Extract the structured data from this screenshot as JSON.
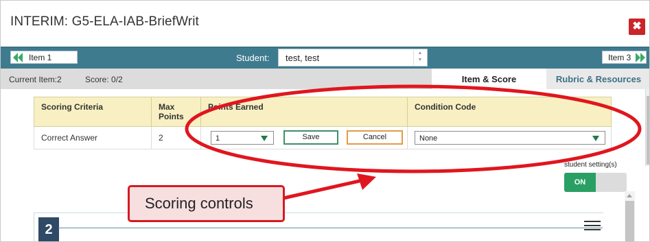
{
  "window": {
    "title": "INTERIM: G5-ELA-IAB-BriefWrit",
    "close_label": "✖"
  },
  "navbar": {
    "prev_item": "Item 1",
    "next_item": "Item 3",
    "student_label": "Student:",
    "student_value": "test, test"
  },
  "infobar": {
    "current_item": "Current Item:2",
    "score": "Score: 0/2",
    "tabs": [
      {
        "label": "Item & Score",
        "active": true
      },
      {
        "label": "Rubric & Resources",
        "active": false
      }
    ]
  },
  "scoring_table": {
    "headers": [
      "Scoring Criteria",
      "Max Points",
      "Points Earned",
      "Condition Code"
    ],
    "row": {
      "criteria": "Correct Answer",
      "max_points": "2",
      "points_earned_value": "1",
      "save_label": "Save",
      "cancel_label": "Cancel",
      "condition_code_value": "None"
    }
  },
  "student_setting": {
    "label": "student setting(s)",
    "toggle_on_label": "ON"
  },
  "passage": {
    "item_number": "2"
  },
  "annotation": {
    "callout_text": "Scoring controls",
    "color": "#e0161e"
  },
  "colors": {
    "navbar": "#3f7b8f",
    "accent_green": "#2a9f64",
    "close_red": "#c9252a",
    "header_yellow": "#f8f0c2"
  }
}
